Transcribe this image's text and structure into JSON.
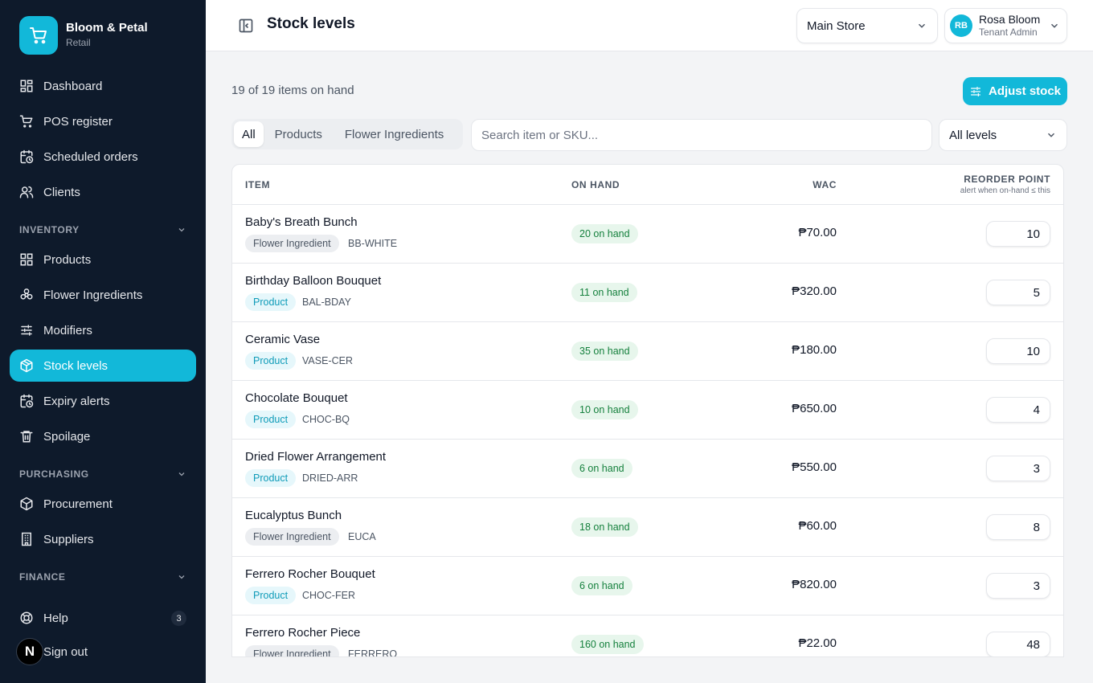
{
  "brand": {
    "name": "Bloom & Petal",
    "subtitle": "Retail"
  },
  "nav": {
    "dashboard": "Dashboard",
    "pos": "POS register",
    "scheduled": "Scheduled orders",
    "clients": "Clients",
    "inventory_section": "INVENTORY",
    "products": "Products",
    "flower_ingredients": "Flower Ingredients",
    "modifiers": "Modifiers",
    "stock_levels": "Stock levels",
    "expiry_alerts": "Expiry alerts",
    "spoilage": "Spoilage",
    "purchasing_section": "PURCHASING",
    "procurement": "Procurement",
    "suppliers": "Suppliers",
    "finance_section": "FINANCE",
    "help": "Help",
    "help_count": "3",
    "sign_out": "Sign out",
    "n_badge": "N"
  },
  "header": {
    "title": "Stock levels",
    "store": "Main Store",
    "user_initials": "RB",
    "user_name": "Rosa Bloom",
    "user_role": "Tenant Admin"
  },
  "toolbar": {
    "items_count": "19 of 19 items on hand",
    "adjust_label": "Adjust stock",
    "tabs": [
      "All",
      "Products",
      "Flower Ingredients"
    ],
    "search_placeholder": "Search item or SKU...",
    "level_filter": "All levels"
  },
  "table": {
    "headers": {
      "item": "ITEM",
      "on_hand": "ON HAND",
      "wac": "WAC",
      "reorder": "REORDER POINT",
      "reorder_sub": "alert when on-hand ≤ this"
    },
    "rows": [
      {
        "name": "Baby's Breath Bunch",
        "type": "Flower Ingredient",
        "sku": "BB-WHITE",
        "on_hand": "20 on hand",
        "wac": "₱70.00",
        "reorder": "10"
      },
      {
        "name": "Birthday Balloon Bouquet",
        "type": "Product",
        "sku": "BAL-BDAY",
        "on_hand": "11 on hand",
        "wac": "₱320.00",
        "reorder": "5"
      },
      {
        "name": "Ceramic Vase",
        "type": "Product",
        "sku": "VASE-CER",
        "on_hand": "35 on hand",
        "wac": "₱180.00",
        "reorder": "10"
      },
      {
        "name": "Chocolate Bouquet",
        "type": "Product",
        "sku": "CHOC-BQ",
        "on_hand": "10 on hand",
        "wac": "₱650.00",
        "reorder": "4"
      },
      {
        "name": "Dried Flower Arrangement",
        "type": "Product",
        "sku": "DRIED-ARR",
        "on_hand": "6 on hand",
        "wac": "₱550.00",
        "reorder": "3"
      },
      {
        "name": "Eucalyptus Bunch",
        "type": "Flower Ingredient",
        "sku": "EUCA",
        "on_hand": "18 on hand",
        "wac": "₱60.00",
        "reorder": "8"
      },
      {
        "name": "Ferrero Rocher Bouquet",
        "type": "Product",
        "sku": "CHOC-FER",
        "on_hand": "6 on hand",
        "wac": "₱820.00",
        "reorder": "3"
      },
      {
        "name": "Ferrero Rocher Piece",
        "type": "Flower Ingredient",
        "sku": "FERRERO",
        "on_hand": "160 on hand",
        "wac": "₱22.00",
        "reorder": "48"
      }
    ]
  },
  "colors": {
    "accent": "#12b8d9",
    "sidebar": "#0e1a2b",
    "success": "#15803d"
  }
}
